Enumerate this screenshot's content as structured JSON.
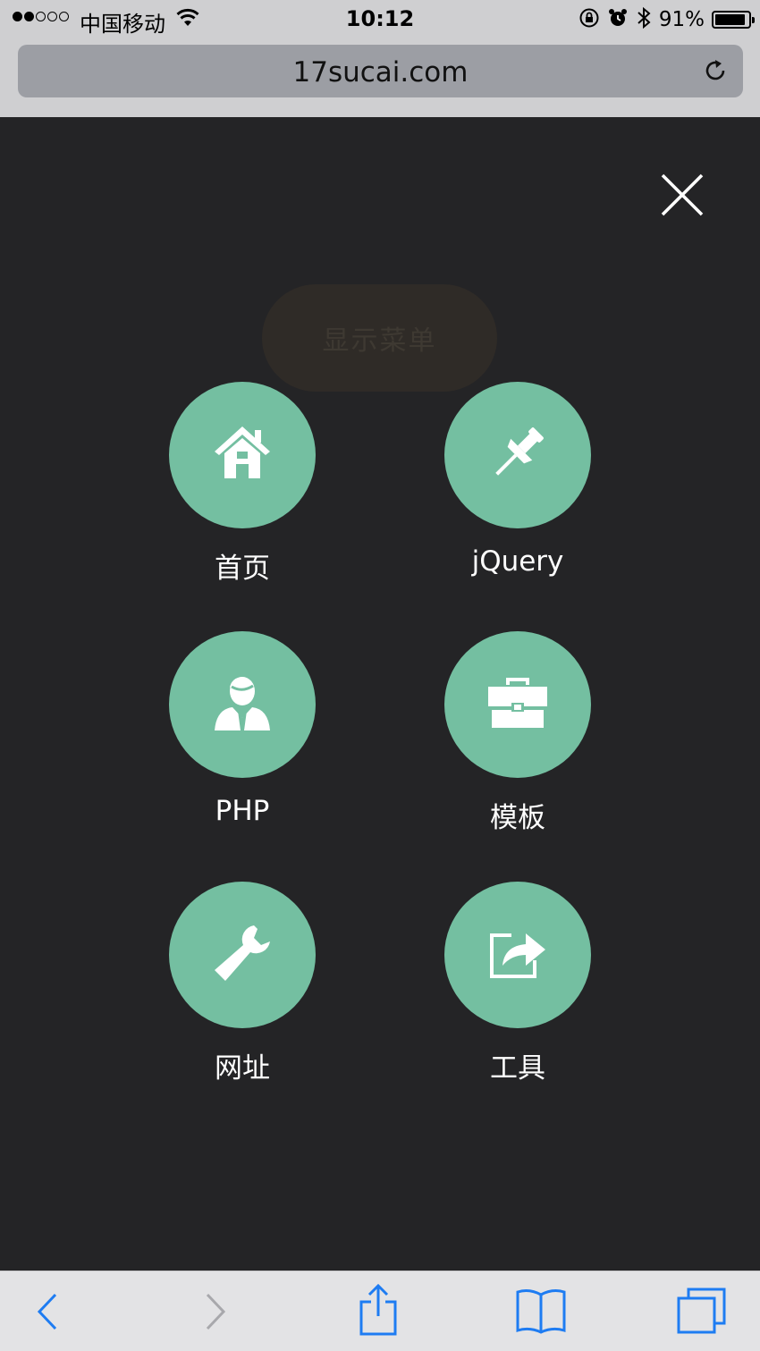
{
  "status_bar": {
    "carrier": "中国移动",
    "time": "10:12",
    "battery_percent": "91%",
    "battery_level": 0.91,
    "signal_bars_filled": 2,
    "signal_bars_total": 5
  },
  "browser": {
    "url": "17sucai.com"
  },
  "overlay": {
    "toggle_label": "显示菜单",
    "close_icon": "close-icon"
  },
  "menu": {
    "items": [
      {
        "label": "首页",
        "icon": "home-icon"
      },
      {
        "label": "jQuery",
        "icon": "pushpin-icon"
      },
      {
        "label": "PHP",
        "icon": "user-icon"
      },
      {
        "label": "模板",
        "icon": "briefcase-icon"
      },
      {
        "label": "网址",
        "icon": "wrench-icon"
      },
      {
        "label": "工具",
        "icon": "share-icon"
      }
    ]
  },
  "toolbar": {
    "buttons": [
      "back-icon",
      "forward-icon",
      "share-icon",
      "bookmarks-icon",
      "tabs-icon"
    ]
  },
  "colors": {
    "overlay_bg": "#242426",
    "accent": "#74bfa1",
    "ios_blue": "#1e7cf2"
  }
}
